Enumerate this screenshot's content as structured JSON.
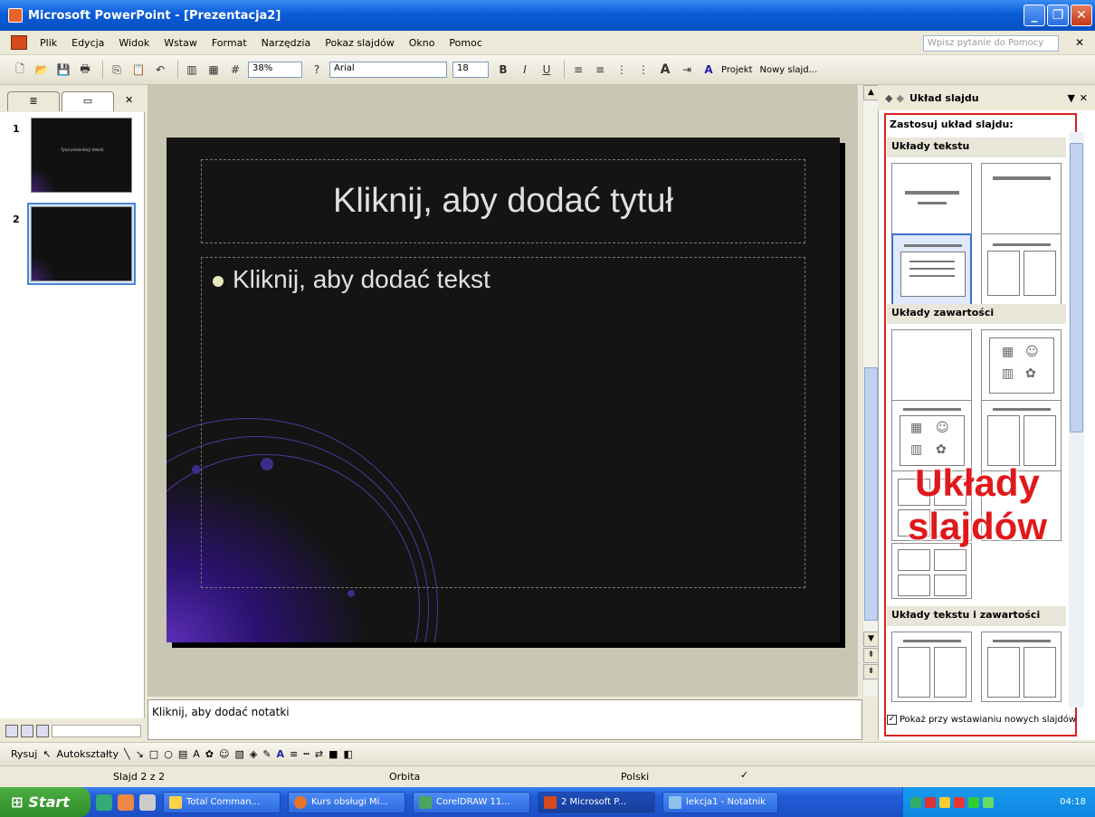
{
  "window": {
    "title": "Microsoft PowerPoint - [Prezentacja2]"
  },
  "menu": {
    "items": [
      "Plik",
      "Edycja",
      "Widok",
      "Wstaw",
      "Format",
      "Narzędzia",
      "Pokaz slajdów",
      "Okno",
      "Pomoc"
    ],
    "help_placeholder": "Wpisz pytanie do Pomocy"
  },
  "toolbar": {
    "zoom": "38%",
    "font_name": "Arial",
    "font_size": "18",
    "design_label": "Projekt",
    "new_slide_label": "Nowy slajd..."
  },
  "slides_pane": {
    "slide_numbers": [
      "1",
      "2"
    ],
    "thumb1_text": "Tytuł prezentacji (tekst)"
  },
  "slide": {
    "title_placeholder": "Kliknij, aby dodać tytuł",
    "body_placeholder": "Kliknij, aby dodać tekst"
  },
  "notes": {
    "placeholder": "Kliknij, aby dodać notatki"
  },
  "task_pane": {
    "title": "Układ slajdu",
    "apply_label": "Zastosuj układ slajdu:",
    "section_text": "Układy tekstu",
    "section_content": "Układy zawartości",
    "section_text_content": "Układy tekstu i zawartości",
    "overlay_text_line1": "Układy",
    "overlay_text_line2": "slajdów",
    "overlay_color": "#e0181b",
    "show_on_insert": "Pokaż przy wstawianiu nowych slajdów",
    "show_on_insert_checked": true
  },
  "drawing_toolbar": {
    "draw_label": "Rysuj",
    "autoshapes_label": "Autokształty"
  },
  "status": {
    "slide_info": "Slajd 2 z 2",
    "design_name": "Orbita",
    "language": "Polski"
  },
  "taskbar": {
    "start_label": "Start",
    "tasks": [
      {
        "label": "Total Comman...",
        "active": false
      },
      {
        "label": "Kurs obsługi Mi...",
        "active": false
      },
      {
        "label": "CorelDRAW 11...",
        "active": false
      },
      {
        "label": "2 Microsoft P...",
        "active": true
      },
      {
        "label": "lekcja1 - Notatnik",
        "active": false
      }
    ],
    "clock": "04:18"
  }
}
